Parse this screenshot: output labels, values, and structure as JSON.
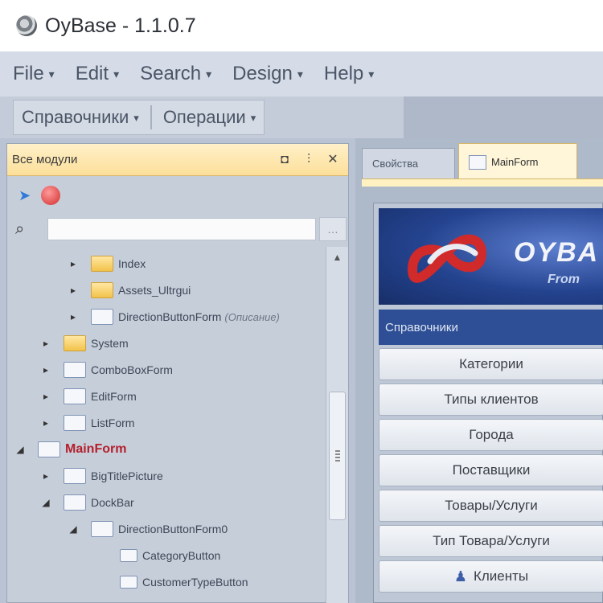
{
  "window": {
    "title": "OyBase - 1.1.0.7",
    "icon": "app-logo-icon"
  },
  "menubar": {
    "items": [
      {
        "label": "File"
      },
      {
        "label": "Edit"
      },
      {
        "label": "Search"
      },
      {
        "label": "Design"
      },
      {
        "label": "Help"
      }
    ]
  },
  "toolbar": {
    "items": [
      {
        "label": "Справочники"
      },
      {
        "label": "Операции"
      }
    ]
  },
  "panel": {
    "title": "Все модули",
    "header_buttons": [
      "window-position-icon",
      "pin-icon",
      "close-icon"
    ],
    "tools": [
      "navigate-icon",
      "refresh-icon"
    ],
    "search": {
      "value": "",
      "placeholder": ""
    },
    "tree": [
      {
        "label": "Index",
        "icon": "folder",
        "level": 3,
        "expander": "▸"
      },
      {
        "label": "Assets_Ultrgui",
        "icon": "folder",
        "level": 3,
        "expander": "▸"
      },
      {
        "label": "DirectionButtonForm",
        "suffix": "(Описание)",
        "icon": "form",
        "level": 3,
        "expander": "▸"
      },
      {
        "label": "System",
        "icon": "folder",
        "level": 2,
        "expander": "▸"
      },
      {
        "label": "ComboBoxForm",
        "icon": "form",
        "level": 2,
        "expander": "▸"
      },
      {
        "label": "EditForm",
        "icon": "form",
        "level": 2,
        "expander": "▸"
      },
      {
        "label": "ListForm",
        "icon": "form",
        "level": 2,
        "expander": "▸"
      },
      {
        "label": "MainForm",
        "icon": "form",
        "level": 1,
        "expander": "◢",
        "highlight": true
      },
      {
        "label": "BigTitlePicture",
        "icon": "form",
        "level": 2,
        "expander": "▸"
      },
      {
        "label": "DockBar",
        "icon": "form",
        "level": 2,
        "expander": "◢"
      },
      {
        "label": "DirectionButtonForm0",
        "icon": "form",
        "level": 3,
        "expander": "◢"
      },
      {
        "label": "CategoryButton",
        "icon": "small",
        "level": 4,
        "expander": ""
      },
      {
        "label": "CustomerTypeButton",
        "icon": "small",
        "level": 4,
        "expander": ""
      }
    ]
  },
  "document": {
    "tabs": [
      {
        "label": "Свойства",
        "active": false
      },
      {
        "label": "MainForm",
        "active": true
      }
    ],
    "banner": {
      "brand": "OYBA",
      "subtitle": "From"
    },
    "section_header": "Справочники",
    "buttons": [
      {
        "label": "Категории",
        "icon": ""
      },
      {
        "label": "Типы клиентов",
        "icon": ""
      },
      {
        "label": "Города",
        "icon": ""
      },
      {
        "label": "Поставщики",
        "icon": ""
      },
      {
        "label": "Товары/Услуги",
        "icon": ""
      },
      {
        "label": "Тип Товара/Услуги",
        "icon": ""
      },
      {
        "label": "Клиенты",
        "icon": "user-icon"
      }
    ]
  }
}
